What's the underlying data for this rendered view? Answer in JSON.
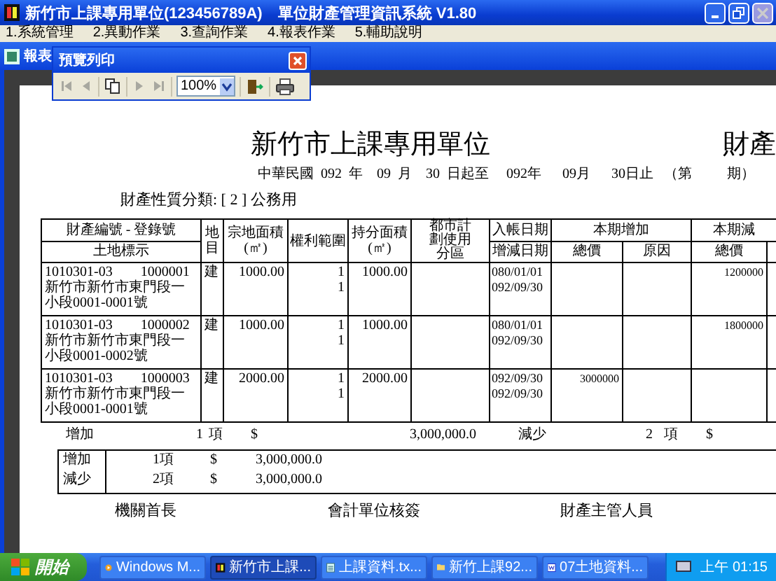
{
  "window": {
    "title": "新竹市上課專用單位(123456789A)　單位財產管理資訊系統 V1.80"
  },
  "menu": [
    {
      "label": "1.系統管理"
    },
    {
      "label": "2.異動作業"
    },
    {
      "label": "3.查詢作業"
    },
    {
      "label": "4.報表作業"
    },
    {
      "label": "5.輔助說明"
    }
  ],
  "child_window": {
    "title": "報表"
  },
  "preview_toolbar": {
    "title": "預覽列印",
    "tools": [
      {
        "kind": "first",
        "disabled": true
      },
      {
        "kind": "prev",
        "disabled": true
      },
      {
        "kind": "pages",
        "disabled": false
      },
      {
        "kind": "next",
        "disabled": true
      },
      {
        "kind": "last",
        "disabled": true
      },
      {
        "kind": "zoom",
        "value": "100%",
        "disabled": false
      },
      {
        "kind": "exit",
        "disabled": false
      },
      {
        "kind": "print",
        "disabled": false
      }
    ]
  },
  "report": {
    "title": "新竹市上課專用單位",
    "title_right": "財產",
    "period": "中華民國  092  年    09  月    30  日起至     092年      09月      30日止   （第          期）",
    "category": "財產性質分類: [  2  ] 公務用",
    "columns": {
      "property_no": "財產編號 - 登錄號",
      "land_mark": "土地標示",
      "land_type": "地目",
      "area": "宗地面積",
      "area_unit": "(㎡)",
      "rights": "權利範圍",
      "share_area": "持分面積",
      "share_unit": "(㎡)",
      "zoning": "都市計劃使用分區",
      "entry_date": "入帳日期",
      "change_date": "增減日期",
      "increase": "本期增加",
      "decrease": "本期減",
      "total": "總價",
      "reason": "原因",
      "total_2": "總價"
    },
    "rows": [
      {
        "property_no": "1010301-03　　1000001",
        "location": "新竹市新竹市東門段一小段0001-0001號",
        "land_type": "建",
        "area": "1000.00",
        "rights": [
          "1",
          "1"
        ],
        "share_area": "1000.00",
        "dates": [
          "080/01/01",
          "092/09/30"
        ],
        "increase_total": "",
        "decrease_total": "1200000"
      },
      {
        "property_no": "1010301-03　　1000002",
        "location": "新竹市新竹市東門段一小段0001-0002號",
        "land_type": "建",
        "area": "1000.00",
        "rights": [
          "1",
          "1"
        ],
        "share_area": "1000.00",
        "dates": [
          "080/01/01",
          "092/09/30"
        ],
        "increase_total": "",
        "decrease_total": "1800000"
      },
      {
        "property_no": "1010301-03　　1000003",
        "location": "新竹市新竹市東門段一小段0001-0001號",
        "land_type": "建",
        "area": "2000.00",
        "rights": [
          "1",
          "1"
        ],
        "share_area": "2000.00",
        "dates": [
          "092/09/30",
          "092/09/30"
        ],
        "increase_total": "3000000",
        "decrease_total": ""
      }
    ],
    "summary": {
      "increase": {
        "label": "增加",
        "count": "1",
        "unit": "項",
        "currency": "$",
        "amount": "3,000,000.0"
      },
      "decrease": {
        "label": "減少",
        "count": "2",
        "unit": "項",
        "currency": "$"
      }
    },
    "totals": [
      {
        "label": "增加",
        "count": "1",
        "unit": "項",
        "currency": "$",
        "amount": "3,000,000.0"
      },
      {
        "label": "減少",
        "count": "2",
        "unit": "項",
        "currency": "$",
        "amount": "3,000,000.0"
      }
    ],
    "signatures": [
      "機關首長",
      "會計單位核簽",
      "財產主管人員"
    ]
  },
  "taskbar": {
    "start": "開始",
    "items": [
      {
        "kind": "media",
        "label": "Windows M...",
        "selected": false
      },
      {
        "kind": "app",
        "label": "新竹市上課...",
        "selected": true
      },
      {
        "kind": "notepad",
        "label": "上課資料.tx...",
        "selected": false
      },
      {
        "kind": "folder",
        "label": "新竹上課92...",
        "selected": false
      },
      {
        "kind": "word",
        "label": "07土地資料...",
        "selected": false
      }
    ],
    "clock": "上午 01:15"
  }
}
